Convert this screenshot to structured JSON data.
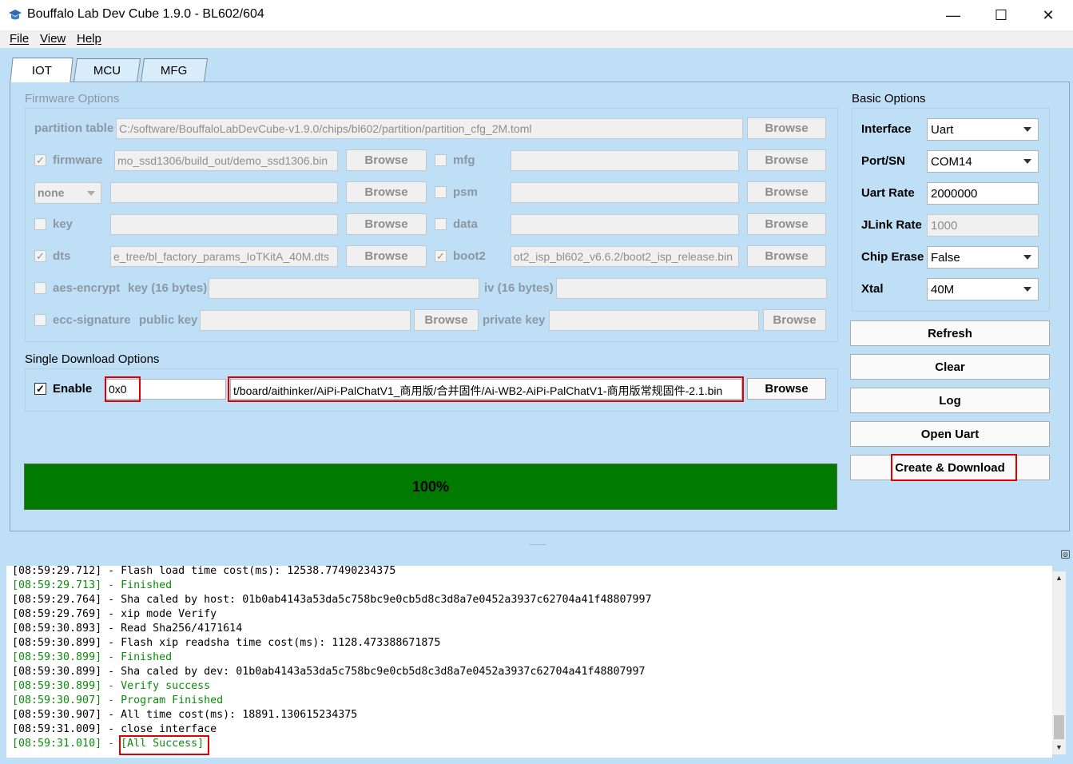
{
  "window": {
    "title": "Bouffalo Lab Dev Cube 1.9.0 - BL602/604",
    "min": "—",
    "max": "☐",
    "close": "✕"
  },
  "menu": [
    "File",
    "View",
    "Help"
  ],
  "tabs": [
    "IOT",
    "MCU",
    "MFG"
  ],
  "firmware": {
    "group_title": "Firmware Options",
    "partition_label": "partition table",
    "partition_value": "C:/software/BouffaloLabDevCube-v1.9.0/chips/bl602/partition/partition_cfg_2M.toml",
    "browse": "Browse",
    "firmware_label": "firmware",
    "firmware_value": "mo_ssd1306/build_out/demo_ssd1306.bin",
    "mfg_label": "mfg",
    "none_value": "none",
    "psm_label": "psm",
    "key_label": "key",
    "data_label": "data",
    "dts_label": "dts",
    "dts_value": "e_tree/bl_factory_params_IoTKitA_40M.dts",
    "boot2_label": "boot2",
    "boot2_value": "ot2_isp_bl602_v6.6.2/boot2_isp_release.bin",
    "aes_label": "aes-encrypt",
    "aes_key_label": "key (16 bytes)",
    "iv_label": "iv (16 bytes)",
    "ecc_label": "ecc-signature",
    "public_key_label": "public key",
    "private_key_label": "private key"
  },
  "single": {
    "group_title": "Single Download Options",
    "enable_label": "Enable",
    "address": "0x0",
    "path": "t/board/aithinker/AiPi-PalChatV1_商用版/合并固件/Ai-WB2-AiPi-PalChatV1-商用版常规固件-2.1.bin",
    "browse": "Browse"
  },
  "progress": {
    "label": "100%",
    "value": 1.0
  },
  "basic": {
    "group_title": "Basic Options",
    "interface_label": "Interface",
    "interface_value": "Uart",
    "port_label": "Port/SN",
    "port_value": "COM14",
    "uart_rate_label": "Uart Rate",
    "uart_rate_value": "2000000",
    "jlink_rate_label": "JLink Rate",
    "jlink_rate_value": "1000",
    "chip_erase_label": "Chip Erase",
    "chip_erase_value": "False",
    "xtal_label": "Xtal",
    "xtal_value": "40M"
  },
  "actions": {
    "refresh": "Refresh",
    "clear": "Clear",
    "log": "Log",
    "open_uart": "Open Uart",
    "create_download": "Create & Download"
  },
  "log": {
    "lines": [
      {
        "text": "[08:59:29.712] - Flash load time cost(ms): 12538.77490234375",
        "status": "normal"
      },
      {
        "text": "[08:59:29.713] - Finished",
        "status": "success"
      },
      {
        "text": "[08:59:29.764] - Sha caled by host: 01b0ab4143a53da5c758bc9e0cb5d8c3d8a7e0452a3937c62704a41f48807997",
        "status": "normal"
      },
      {
        "text": "[08:59:29.769] - xip mode Verify",
        "status": "normal"
      },
      {
        "text": "[08:59:30.893] - Read Sha256/4171614",
        "status": "normal"
      },
      {
        "text": "[08:59:30.899] - Flash xip readsha time cost(ms): 1128.473388671875",
        "status": "normal"
      },
      {
        "text": "[08:59:30.899] - Finished",
        "status": "success"
      },
      {
        "text": "[08:59:30.899] - Sha caled by dev: 01b0ab4143a53da5c758bc9e0cb5d8c3d8a7e0452a3937c62704a41f48807997",
        "status": "normal"
      },
      {
        "text": "[08:59:30.899] - Verify success",
        "status": "success"
      },
      {
        "text": "[08:59:30.907] - Program Finished",
        "status": "success"
      },
      {
        "text": "[08:59:30.907] - All time cost(ms): 18891.130615234375",
        "status": "normal"
      },
      {
        "text": "[08:59:31.009] - close interface",
        "status": "normal"
      },
      {
        "text": "[08:59:31.010] - [All Success]",
        "status": "success"
      }
    ]
  },
  "colors": {
    "background": "#bedff5",
    "progress": "#007b00",
    "success_text": "#0d8a0d",
    "highlight": "#e00000"
  }
}
